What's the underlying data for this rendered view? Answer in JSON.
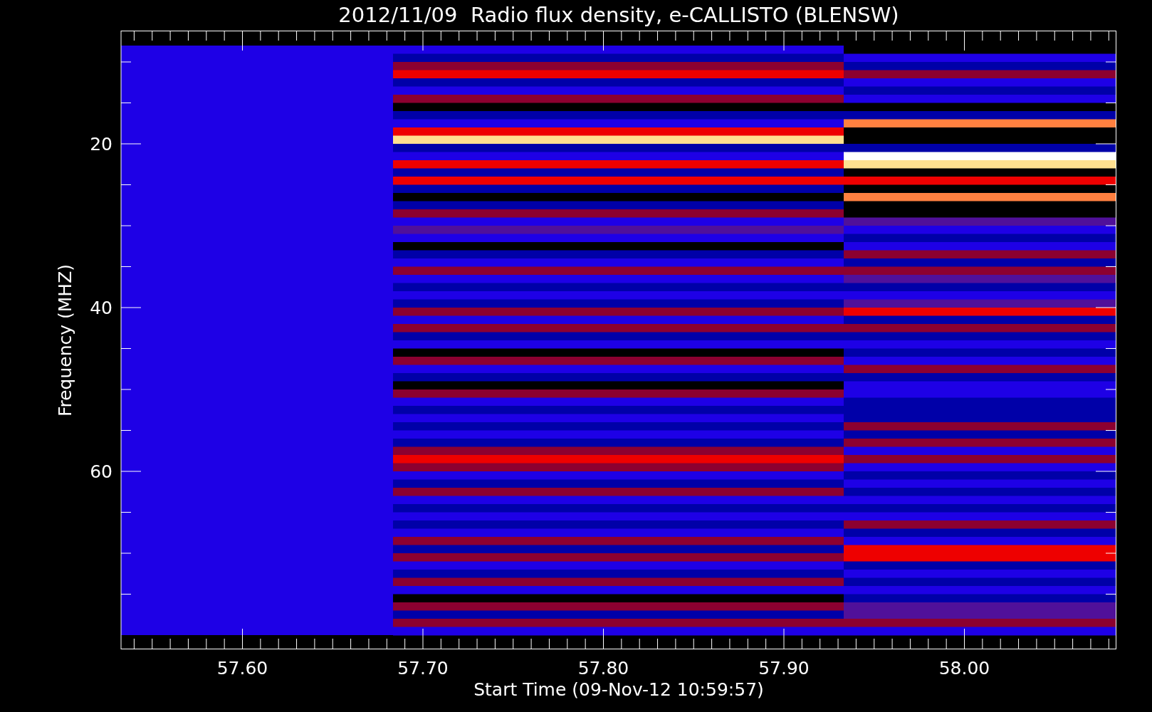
{
  "title": "2012/11/09  Radio flux density, e-CALLISTO (BLENSW)",
  "y_axis": {
    "label": "Frequency (MHZ)",
    "ticks": [
      "20",
      "40",
      "60"
    ]
  },
  "x_axis": {
    "label": "Start Time (09-Nov-12 10:59:57)",
    "ticks": [
      "57.60",
      "57.70",
      "57.80",
      "57.90",
      "58.00"
    ]
  }
}
